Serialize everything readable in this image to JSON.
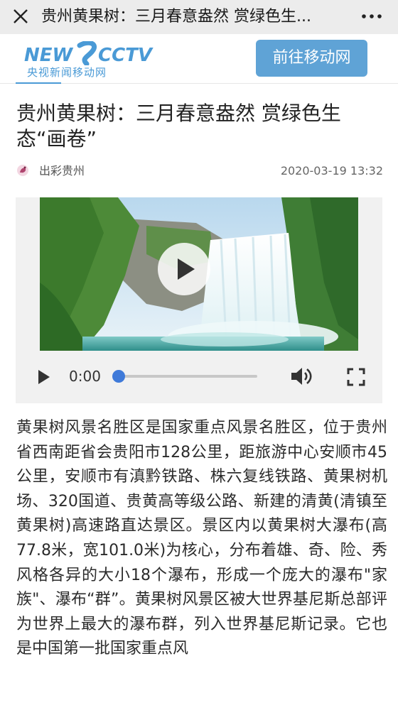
{
  "topbar": {
    "title": "贵州黄果树：三月春意盎然 赏绿色生...",
    "close_icon": "close-icon",
    "more_icon": "more-dots-icon"
  },
  "header": {
    "logo_text": "NEW CCTV",
    "logo_sub": "央视新闻移动网",
    "goto_label": "前往移动网",
    "accent_color": "#5fa3d6"
  },
  "article": {
    "title": "贵州黄果树：三月春意盎然 赏绿色生态“画卷”",
    "source": "出彩贵州",
    "time": "2020-03-19 13:32",
    "body": "黄果树风景名胜区是国家重点风景名胜区，位于贵州省西南距省会贵阳市128公里，距旅游中心安顺市45公里，安顺市有滇黔铁路、株六复线铁路、黄果树机场、320国道、贵黄高等级公路、新建的清黄(清镇至黄果树)高速路直达景区。景区内以黄果树大瀑布(高77.8米，宽101.0米)为核心，分布着雄、奇、险、秀风格各异的大小18个瀑布，形成一个庞大的瀑布\"家族\"、瀑布“群”。黄果树风景区被大世界基尼斯总部评为世界上最大的瀑布群，列入世界基尼斯记录。它也是中国第一批国家重点风"
  },
  "video": {
    "current_time": "0:00",
    "progress": 0,
    "thumb_color": "#3f7ad9"
  }
}
